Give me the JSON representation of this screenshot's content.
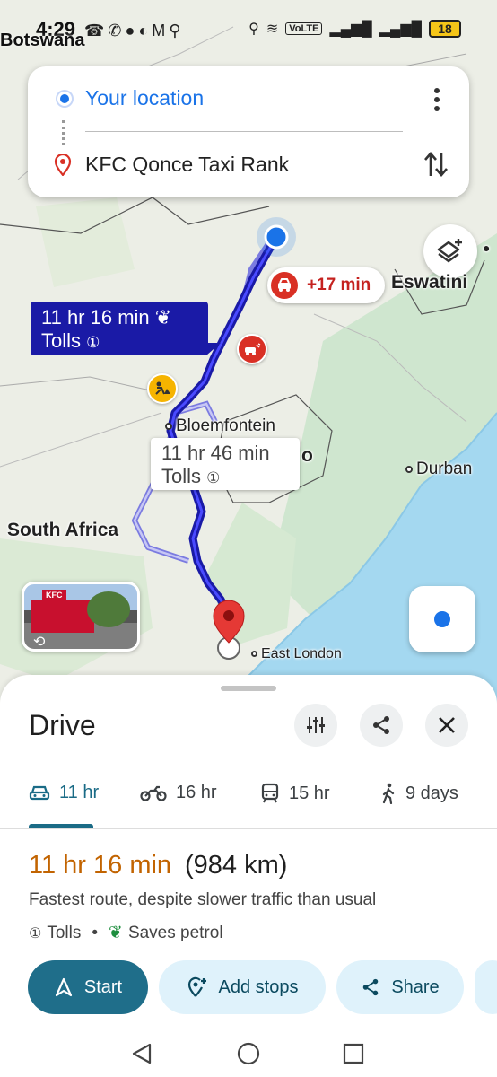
{
  "status_bar": {
    "time": "4:29",
    "battery": "18",
    "network": "VoLTE"
  },
  "map": {
    "labels": {
      "botswana": "Botswana",
      "eswatini": "Eswatini",
      "bloemfontein": "Bloemfontein",
      "durban": "Durban",
      "south_africa": "South Africa",
      "east_london": "East London",
      "o_label": "o"
    },
    "traffic_badge": "+17 min",
    "route_main": {
      "time": "11 hr 16 min",
      "tolls": "Tolls"
    },
    "route_alt": {
      "time": "11 hr 46 min",
      "tolls": "Tolls"
    },
    "streetview": {
      "sign": "KFC"
    }
  },
  "search": {
    "origin": "Your location",
    "destination": "KFC Qonce Taxi Rank"
  },
  "sheet": {
    "title": "Drive",
    "modes": [
      {
        "label": "11 hr",
        "icon": "car-icon"
      },
      {
        "label": "16 hr",
        "icon": "motorbike-icon"
      },
      {
        "label": "15 hr",
        "icon": "transit-icon"
      },
      {
        "label": "9 days",
        "icon": "walk-icon"
      }
    ],
    "duration": "11 hr 16 min",
    "distance": "(984 km)",
    "description": "Fastest route, despite slower traffic than usual",
    "tags": {
      "tolls": "Tolls",
      "eco": "Saves petrol"
    },
    "actions": {
      "start": "Start",
      "add_stops": "Add stops",
      "share": "Share"
    }
  },
  "colors": {
    "accent": "#1a73e8",
    "route_primary": "#1a1aa6",
    "duration_orange": "#c26401",
    "traffic_red": "#d93025",
    "button_teal": "#1f6e8a",
    "ocean": "#a4d8f0"
  }
}
